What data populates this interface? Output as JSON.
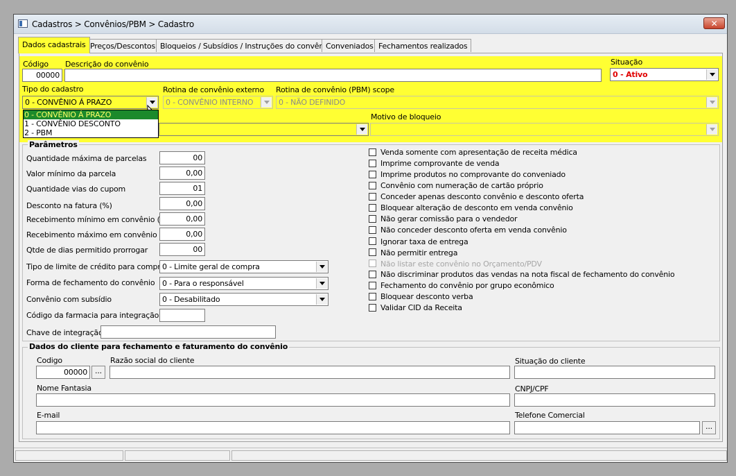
{
  "window": {
    "title": "Cadastros > Convênios/PBM > Cadastro",
    "close_label": "✕"
  },
  "tabs": [
    "Dados cadastrais",
    "Preços/Descontos",
    "Bloqueios / Subsídios / Instruções do convênio",
    "Conveniados",
    "Fechamentos realizados"
  ],
  "header": {
    "codigo_label": "Código",
    "codigo_value": "00000",
    "descricao_label": "Descrição do convênio",
    "descricao_value": "",
    "situacao_label": "Situação",
    "situacao_value": "0 - Ativo",
    "tipo_label": "Tipo do cadastro",
    "tipo_value": "0 - CONVÊNIO Á PRAZO",
    "tipo_options": [
      "0 - CONVÊNIO Á PRAZO",
      "1 - CONVÊNIO DESCONTO",
      "2 - PBM"
    ],
    "rotina_externo_label": "Rotina de convênio externo",
    "rotina_externo_value": "0 - CONVÊNIO INTERNO",
    "rotina_pbm_label": "Rotina de convênio (PBM) scope",
    "rotina_pbm_value": "0 - NÃO DEFINIDO",
    "motivo_label": "Motivo de bloqueio",
    "motivo_value": ""
  },
  "params": {
    "legend": "Parâmetros",
    "fields": [
      {
        "label": "Quantidade máxima de parcelas",
        "value": "00"
      },
      {
        "label": "Valor mínimo da parcela",
        "value": "0,00"
      },
      {
        "label": "Quantidade vias do cupom",
        "value": "01"
      },
      {
        "label": "Desconto na fatura (%)",
        "value": "0,00"
      },
      {
        "label": "Recebimento mínimo em convênio (%)",
        "value": "0,00"
      },
      {
        "label": "Recebimento máximo em convênio (%)",
        "value": "0,00"
      },
      {
        "label": "Qtde de dias permitido prorrogar",
        "value": "00"
      }
    ],
    "selects": [
      {
        "label": "Tipo de limite de crédito para compra",
        "value": "0 - Limite geral de compra"
      },
      {
        "label": "Forma de fechamento do convênio",
        "value": "0 - Para o responsável"
      },
      {
        "label": "Convênio com subsídio",
        "value": "0 - Desabilitado"
      }
    ],
    "farmacia_label": "Código da farmacia para integração",
    "farmacia_value": "",
    "chave_label": "Chave de integração",
    "chave_value": "",
    "checkboxes": [
      "Venda somente com apresentação de receita médica",
      "Imprime comprovante de venda",
      "Imprime produtos no comprovante do conveniado",
      "Convênio com numeração de cartão próprio",
      "Conceder apenas desconto convênio e desconto oferta",
      "Bloquear alteração de desconto em venda convênio",
      "Não gerar comissão para o vendedor",
      "Não conceder desconto oferta em venda convênio",
      "Ignorar taxa de entrega",
      "Não permitir entrega",
      "Não listar este convênio no Orçamento/PDV",
      "Não discriminar produtos das vendas na nota fiscal de fechamento do convênio",
      "Fechamento do convênio por grupo econômico",
      "Bloquear desconto verba",
      "Validar CID da Receita"
    ]
  },
  "cliente": {
    "legend": "Dados do cliente para fechamento e faturamento do convênio",
    "codigo_label": "Codigo",
    "codigo_value": "00000",
    "lookup_label": "...",
    "razao_label": "Razão social do cliente",
    "razao_value": "",
    "situacao_label": "Situação do cliente",
    "situacao_value": "",
    "fantasia_label": "Nome Fantasia",
    "fantasia_value": "",
    "cnpj_label": "CNPJ/CPF",
    "cnpj_value": "",
    "email_label": "E-mail",
    "email_value": "",
    "telefone_label": "Telefone Comercial",
    "telefone_value": ""
  },
  "colors": {
    "highlight": "#ffff33",
    "selected_item_bg": "#1c8a2b",
    "situacao_text": "#e00000"
  }
}
